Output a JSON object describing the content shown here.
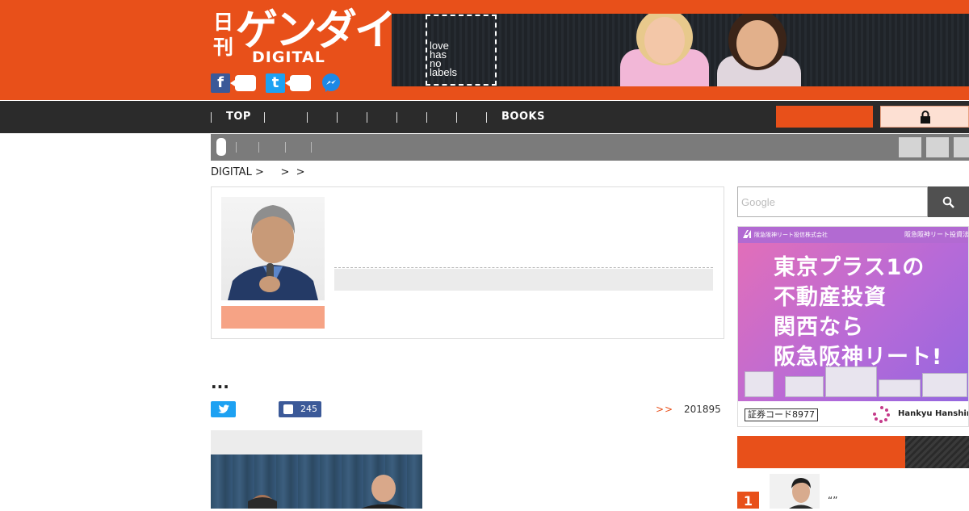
{
  "header": {
    "logo": {
      "kanji": "日刊",
      "kana": "ゲンダイ",
      "latin": "DIGITAL"
    },
    "banner": {
      "text": "love\nhas\nno\nlabels"
    },
    "social": {
      "facebook": "f",
      "twitter": "t"
    }
  },
  "nav": {
    "items": [
      {
        "label": "TOP"
      },
      {
        "label": ""
      },
      {
        "label": ""
      },
      {
        "label": ""
      },
      {
        "label": ""
      },
      {
        "label": ""
      },
      {
        "label": ""
      },
      {
        "label": ""
      },
      {
        "label": "BOOKS"
      }
    ],
    "login_icon": "lock-icon"
  },
  "breadcrumb": {
    "text": "DIGITAL >     >  >"
  },
  "author_card": {
    "name": "",
    "title": ""
  },
  "article": {
    "title": "...",
    "facebook_count": "245",
    "more": ">>",
    "views": "201895"
  },
  "sidebar": {
    "search_placeholder": "Google",
    "search_icon": "search-icon",
    "ad": {
      "corp_left": "阪急阪神リート投信株式会社",
      "corp_right": "阪急阪神リート投資法",
      "copy": "東京プラス1の\n不動産投資\n関西なら\n阪急阪神リート!",
      "code": "証券コード8977",
      "brand": "Hankyu Hanshin REI"
    },
    "ranking": {
      "rank": "1",
      "quote": "“”"
    }
  },
  "colors": {
    "brand": "#e8501a",
    "nav": "#2b2b2b",
    "sub": "#7b7b7b",
    "twitter": "#1da1f2",
    "facebook": "#3b5998"
  }
}
